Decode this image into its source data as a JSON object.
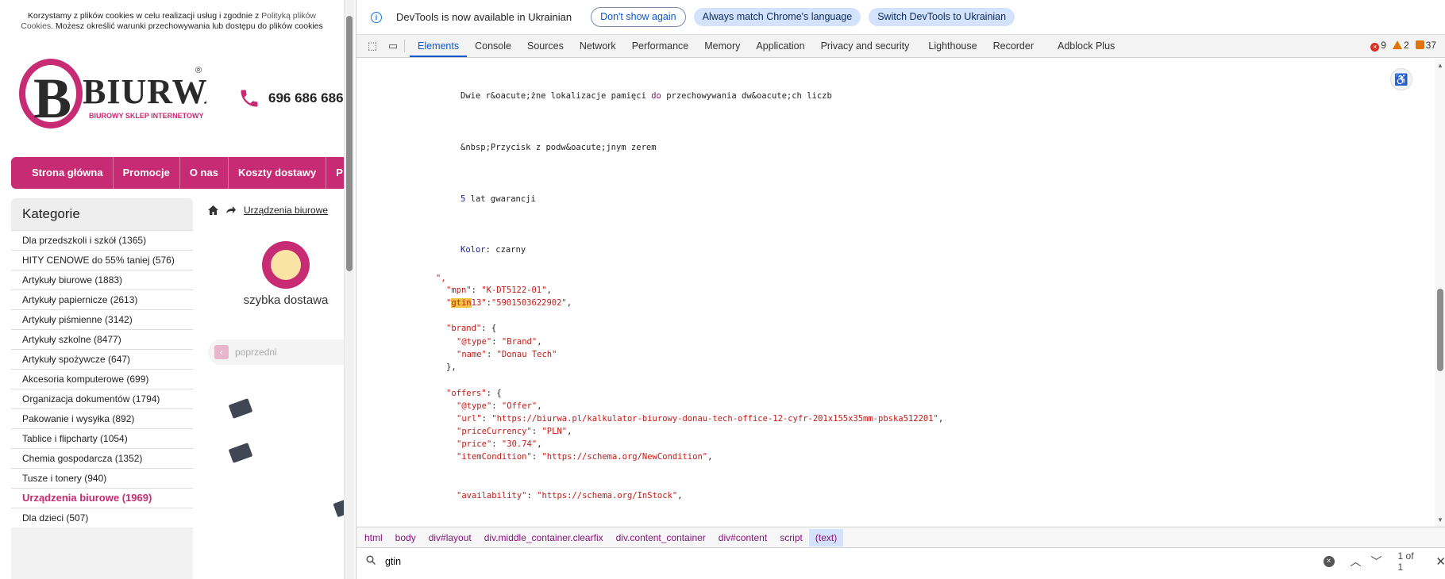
{
  "site": {
    "cookie_text_1": "Korzystamy z plików cookies w celu realizacji usług i zgodnie z ",
    "cookie_link_1": "Polityką plików",
    "cookie_link_2": "Cookies",
    "cookie_text_2": ". Możesz określić warunki przechowywania lub dostępu do plików cookies",
    "logo_name": "BIURWA",
    "logo_tagline": "BIUROWY SKLEP INTERNETOWY",
    "phone": "696 686 686",
    "nav": [
      "Strona główna",
      "Promocje",
      "O nas",
      "Koszty dostawy",
      "P"
    ],
    "categories_title": "Kategorie",
    "categories": [
      "Dla przedszkoli i szkół (1365)",
      "HITY CENOWE do 55% taniej (576)",
      "Artykuły biurowe (1883)",
      "Artykuły papiernicze (2613)",
      "Artykuły piśmienne (3142)",
      "Artykuły szkolne (8477)",
      "Artykuły spożywcze (647)",
      "Akcesoria komputerowe (699)",
      "Organizacja dokumentów (1794)",
      "Pakowanie i wysyłka (892)",
      "Tablice i flipcharty (1054)",
      "Chemia gospodarcza (1352)",
      "Tusze i tonery (940)",
      "Urządzenia biurowe (1969)",
      "Dla dzieci (507)"
    ],
    "active_category_index": 13,
    "breadcrumb_link": "Urządzenia biurowe",
    "fast_delivery": "szybka dostawa",
    "prev_label": "poprzedni"
  },
  "devtools": {
    "infobar_text": "DevTools is now available in Ukrainian",
    "btn_dont_show": "Don't show again",
    "btn_match": "Always match Chrome's language",
    "btn_switch": "Switch DevTools to Ukrainian",
    "tabs": [
      "Elements",
      "Console",
      "Sources",
      "Network",
      "Performance",
      "Memory",
      "Application",
      "Privacy and security",
      "Lighthouse",
      "Recorder",
      "Adblock Plus"
    ],
    "active_tab": "Elements",
    "errors": "9",
    "warnings": "2",
    "messages": "37",
    "breadcrumbs": [
      "html",
      "body",
      "div#layout",
      "div.middle_container.clearfix",
      "div.content_container",
      "div#content",
      "script",
      "(text)"
    ],
    "search_value": "gtin",
    "search_result": "1 of 1",
    "code": {
      "l1_a": "Dwie r&oacute;żne lokalizacje pamięci ",
      "l1_k": "do",
      "l1_b": " przechowywania dw&oacute;ch liczb",
      "l2": "&nbsp;Przycisk z podw&oacute;jnym zerem",
      "l3_n": "5",
      "l3_b": " lat gwarancji",
      "l4_k": "Kolor",
      "l4_b": ": czarny",
      "l5": "\",",
      "mpn_key": "\"mpn\"",
      "mpn_val": "\"K-DT5122-01\"",
      "gtin_q": "\"",
      "gtin_hl": "gtin",
      "gtin_rest": "13\"",
      "gtin_val": "\"5901503622902\"",
      "brand_key": "\"brand\"",
      "type_key": "\"@type\"",
      "brand_type_val": "\"Brand\"",
      "name_key": "\"name\"",
      "brand_name_val": "\"Donau Tech\"",
      "offers_key": "\"offers\"",
      "offer_type_val": "\"Offer\"",
      "url_key": "\"url\"",
      "url_val": "\"https://biurwa.pl/kalkulator-biurowy-donau-tech-office-12-cyfr-201x155x35mm-pbska512201\"",
      "currency_key": "\"priceCurrency\"",
      "currency_val": "\"PLN\"",
      "price_key": "\"price\"",
      "price_val": "\"30.74\"",
      "cond_key": "\"itemCondition\"",
      "cond_val": "\"https://schema.org/NewCondition\"",
      "avail_key": "\"availability\"",
      "avail_val": "\"https://schema.org/InStock\""
    }
  }
}
